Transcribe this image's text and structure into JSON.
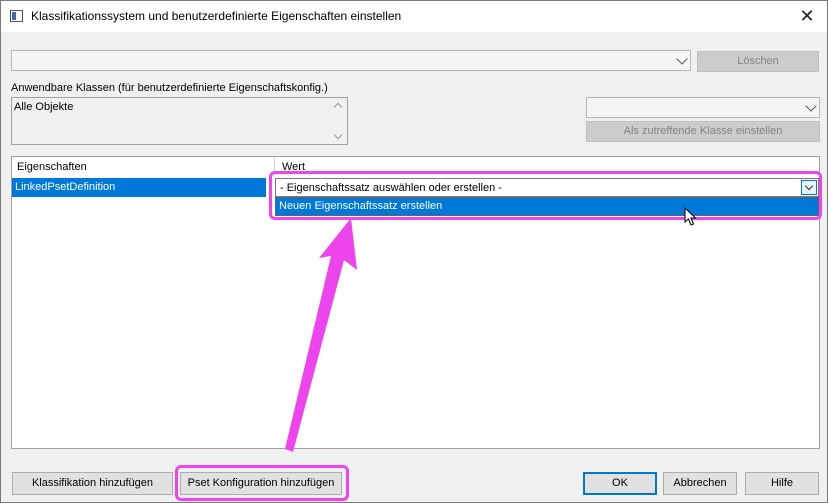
{
  "window": {
    "title": "Klassifikationssystem und benutzerdefinierte Eigenschaften einstellen",
    "close_glyph": "✕"
  },
  "top": {
    "classification_combo_value": "",
    "delete_label": "Löschen"
  },
  "classes": {
    "heading": "Anwendbare Klassen (für benutzerdefinierte Eigenschaftskonfig.)",
    "items": [
      "Alle Objekte"
    ],
    "class_combo_value": "",
    "set_class_label": "Als zutreffende Klasse einstellen"
  },
  "grid": {
    "col_properties": "Eigenschaften",
    "col_value": "Wert",
    "row_property": "LinkedPsetDefinition",
    "value_placeholder": "- Eigenschaftssatz auswählen oder erstellen -",
    "dropdown_option": "Neuen Eigenschaftssatz erstellen"
  },
  "buttons": {
    "add_classification": "Klassifikation hinzufügen",
    "add_pset_config": "Pset Konfiguration hinzufügen",
    "ok": "OK",
    "cancel": "Abbrechen",
    "help": "Hilfe"
  },
  "annotation": {
    "highlight_color": "#ee44ee",
    "selection_color": "#0078d7"
  }
}
